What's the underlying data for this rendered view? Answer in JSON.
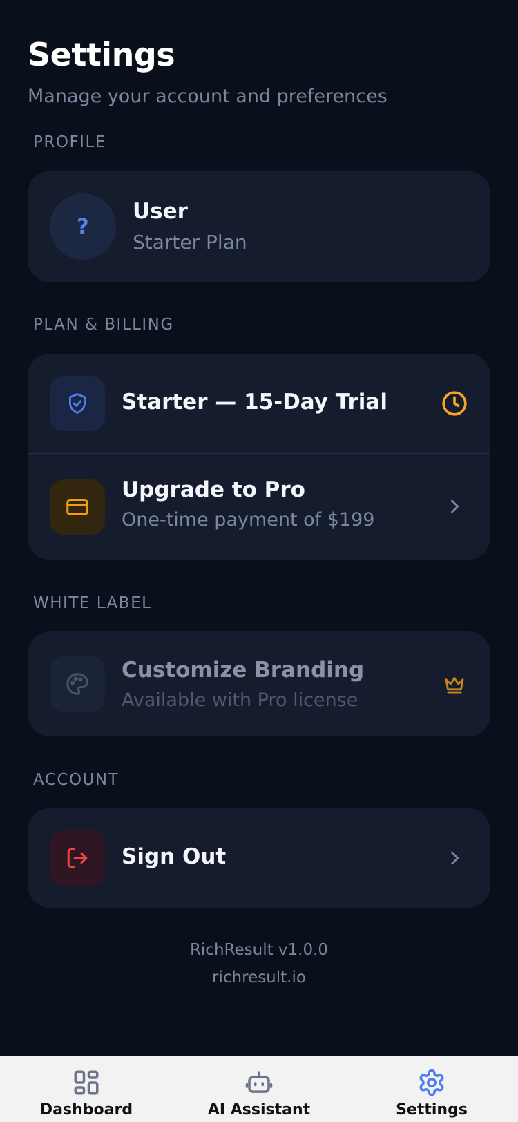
{
  "header": {
    "title": "Settings",
    "subtitle": "Manage your account and preferences"
  },
  "profile": {
    "section_label": "PROFILE",
    "avatar_glyph": "?",
    "name": "User",
    "plan": "Starter Plan"
  },
  "billing": {
    "section_label": "PLAN & BILLING",
    "trial": {
      "title": "Starter — 15-Day Trial",
      "icon": "shield-check-icon",
      "trailing_icon": "clock-icon"
    },
    "upgrade": {
      "title": "Upgrade to Pro",
      "subtitle": "One-time payment of $199",
      "icon": "credit-card-icon",
      "trailing_icon": "chevron-right-icon"
    }
  },
  "white_label": {
    "section_label": "WHITE LABEL",
    "branding": {
      "title": "Customize Branding",
      "subtitle": "Available with Pro license",
      "icon": "palette-icon",
      "trailing_icon": "crown-icon"
    }
  },
  "account": {
    "section_label": "ACCOUNT",
    "sign_out": {
      "title": "Sign Out",
      "icon": "logout-icon",
      "trailing_icon": "chevron-right-icon"
    }
  },
  "footer": {
    "version": "RichResult v1.0.0",
    "website": "richresult.io"
  },
  "tabbar": {
    "tabs": [
      {
        "label": "Dashboard",
        "icon": "dashboard-grid-icon",
        "active": false
      },
      {
        "label": "AI Assistant",
        "icon": "robot-icon",
        "active": false
      },
      {
        "label": "Settings",
        "icon": "gear-icon",
        "active": true
      }
    ]
  },
  "colors": {
    "background": "#0a0f1c",
    "card": "#141c2d",
    "accent_blue": "#4f7cf0",
    "accent_orange": "#f5a524",
    "danger_red": "#ef4444",
    "muted_text": "#7b879d"
  }
}
